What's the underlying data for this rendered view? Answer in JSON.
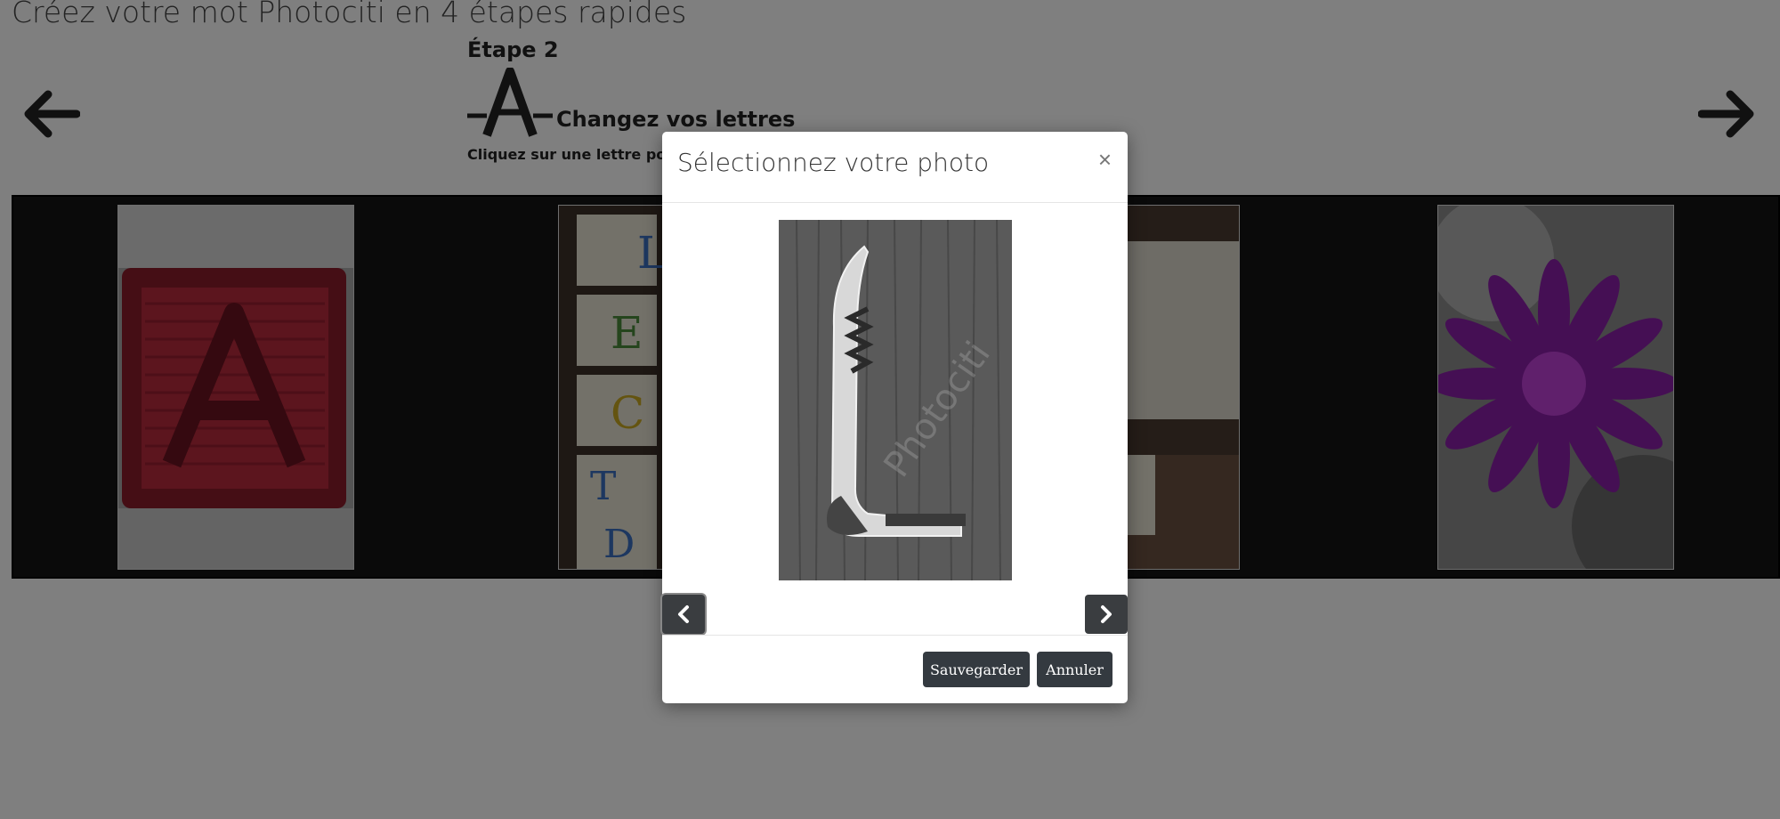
{
  "page": {
    "title": "Créez votre mot Photociti en 4 étapes rapides",
    "step_label": "Étape 2",
    "step_subtitle": "Changez vos lettres",
    "step_instruction": "Cliquez sur une lettre pour changer"
  },
  "nav": {
    "prev_icon": "arrow-left-icon",
    "next_icon": "arrow-right-icon"
  },
  "strip": {
    "tiles": [
      {
        "name": "letter-A-block"
      },
      {
        "name": "letter-blocks-stack"
      },
      {
        "name": "letter-E-blocks"
      },
      {
        "name": "purple-flower"
      }
    ]
  },
  "modal": {
    "title": "Sélectionnez votre photo",
    "close_label": "×",
    "photo_name": "corkscrew-letter-L",
    "watermark": "Photociti",
    "save_label": "Sauvegarder",
    "cancel_label": "Annuler"
  },
  "colors": {
    "overlay": "rgba(0,0,0,0.5)",
    "button": "#343a40",
    "accent_purple": "#8b1fa8"
  }
}
